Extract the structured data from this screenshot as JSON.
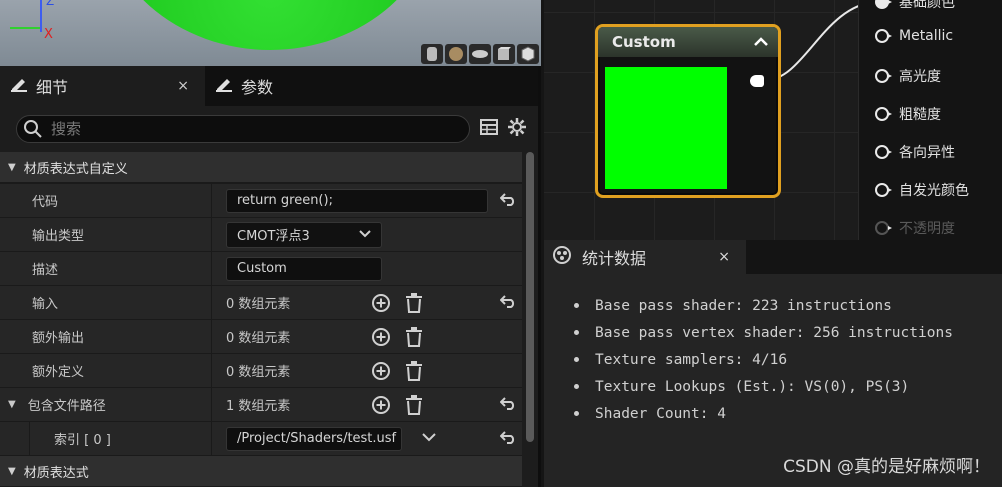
{
  "viewport": {
    "axis_z": "Z",
    "axis_x": "X",
    "preview_shapes": [
      "cylinder-icon",
      "sphere-icon",
      "plane-icon",
      "cube-icon",
      "custom-mesh-icon"
    ]
  },
  "details": {
    "tabs": [
      {
        "label": "细节",
        "icon": "pencil-icon",
        "has_close": true
      },
      {
        "label": "参数",
        "icon": "pencil-icon",
        "has_close": false
      }
    ],
    "close_glyph": "×",
    "search": {
      "placeholder": "搜索"
    },
    "sections": {
      "custom_expr": {
        "label": "材质表达式自定义"
      },
      "expr": {
        "label": "材质表达式"
      }
    },
    "props": {
      "code": {
        "name": "代码",
        "value": "return green();"
      },
      "output_type": {
        "name": "输出类型",
        "value": "CMOT浮点3"
      },
      "description": {
        "name": "描述",
        "value": "Custom"
      },
      "inputs": {
        "name": "输入",
        "value": "0 数组元素"
      },
      "extra_outputs": {
        "name": "额外输出",
        "value": "0 数组元素"
      },
      "extra_defines": {
        "name": "额外定义",
        "value": "0 数组元素"
      },
      "include_paths": {
        "name": "包含文件路径",
        "value": "1 数组元素"
      },
      "index0": {
        "name": "索引 [ 0 ]",
        "value": "/Project/Shaders/test.usf"
      }
    }
  },
  "graph": {
    "node_title": "Custom",
    "node_color": "#e0a020",
    "preview_color": "#00ff00",
    "pins": [
      {
        "label": "基础颜色",
        "filled": true,
        "dim": false
      },
      {
        "label": "Metallic",
        "filled": false,
        "dim": false
      },
      {
        "label": "高光度",
        "filled": false,
        "dim": false
      },
      {
        "label": "粗糙度",
        "filled": false,
        "dim": false
      },
      {
        "label": "各向异性",
        "filled": false,
        "dim": false
      },
      {
        "label": "自发光颜色",
        "filled": false,
        "dim": false
      },
      {
        "label": "不透明度",
        "filled": false,
        "dim": true
      }
    ]
  },
  "stats": {
    "tab_label": "统计数据",
    "items": [
      "Base pass shader: 223 instructions",
      "Base pass vertex shader: 256 instructions",
      "Texture samplers: 4/16",
      "Texture Lookups (Est.): VS(0), PS(3)",
      "Shader Count: 4"
    ]
  },
  "watermark": "CSDN @真的是好麻烦啊！"
}
